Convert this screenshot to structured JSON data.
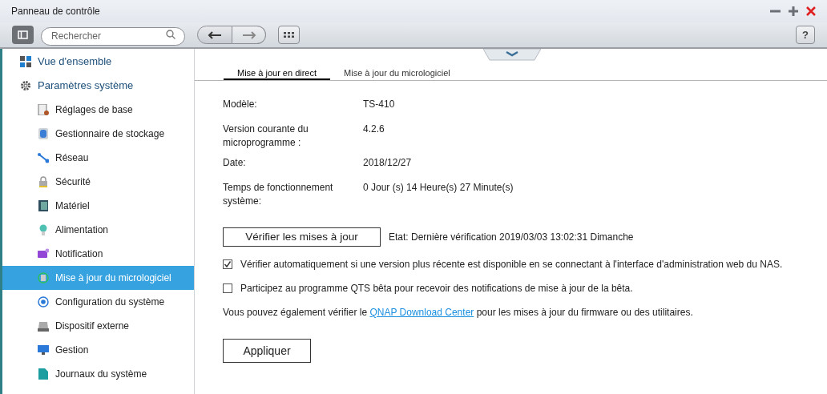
{
  "window": {
    "title": "Panneau de contrôle"
  },
  "toolbar": {
    "search": {
      "placeholder": "Rechercher"
    },
    "help": "?"
  },
  "sidebar": {
    "items": [
      {
        "label": "Vue d'ensemble",
        "selected": false
      },
      {
        "label": "Paramètres système",
        "selected": false,
        "children": [
          {
            "label": "Réglages de base",
            "selected": false
          },
          {
            "label": "Gestionnaire de stockage",
            "selected": false
          },
          {
            "label": "Réseau",
            "selected": false
          },
          {
            "label": "Sécurité",
            "selected": false
          },
          {
            "label": "Matériel",
            "selected": false
          },
          {
            "label": "Alimentation",
            "selected": false
          },
          {
            "label": "Notification",
            "selected": false
          },
          {
            "label": "Mise à jour du micrologiciel",
            "selected": true
          },
          {
            "label": "Configuration du système",
            "selected": false
          },
          {
            "label": "Dispositif externe",
            "selected": false
          },
          {
            "label": "Gestion",
            "selected": false
          },
          {
            "label": "Journaux du système",
            "selected": false
          }
        ]
      }
    ]
  },
  "tabs": [
    {
      "label": "Mise à jour en direct",
      "selected": true
    },
    {
      "label": "Mise à jour du micrologiciel",
      "selected": false
    }
  ],
  "info": [
    {
      "label": "Modèle:",
      "value": "TS-410"
    },
    {
      "label": "Version courante du microprogramme :",
      "value": "4.2.6"
    },
    {
      "label": "Date:",
      "value": "2018/12/27"
    },
    {
      "label": "Temps de fonctionnement système:",
      "value": "0 Jour (s) 14 Heure(s) 27 Minute(s)"
    }
  ],
  "check_button": "Vérifier les mises à jour",
  "status": "Etat: Dernière vérification 2019/03/03 13:02:31 Dimanche",
  "options": [
    {
      "label": "Vérifier automatiquement si une version plus récente est disponible en se connectant à l'interface d'administration web du NAS.",
      "checked": true
    },
    {
      "label": "Participez au programme QTS bêta pour recevoir des notifications de mise à jour de la bêta.",
      "checked": false
    }
  ],
  "note": {
    "before": "Vous pouvez également vérifier le",
    "link": "QNAP Download Center",
    "after": "pour les mises à jour du firmware ou des utilitaires."
  },
  "apply_button": "Appliquer"
}
